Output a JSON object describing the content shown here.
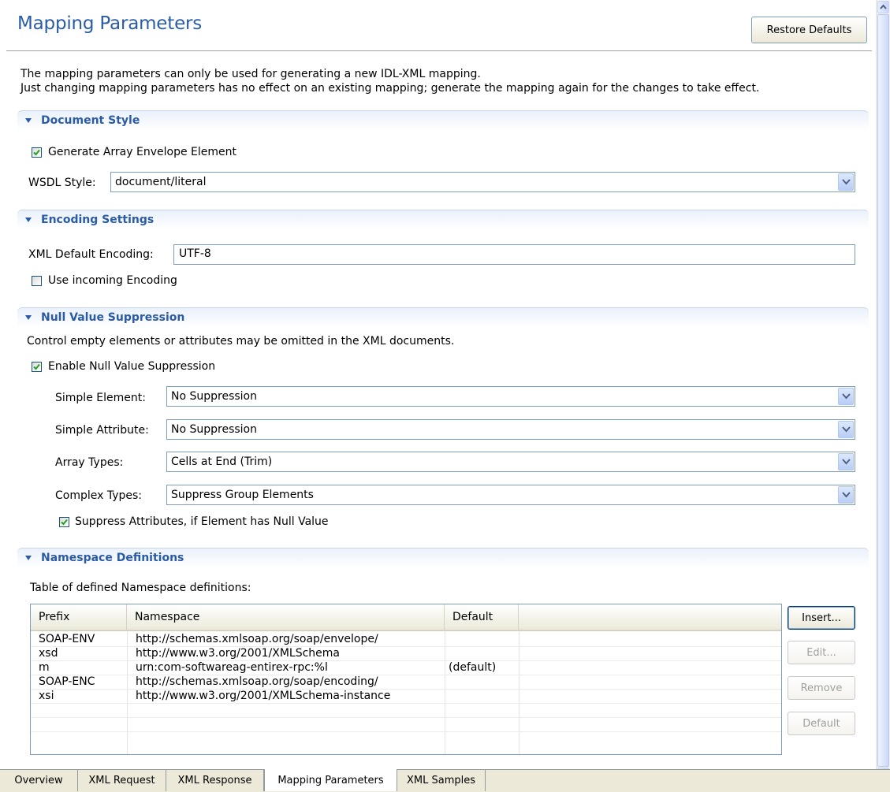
{
  "header": {
    "title": "Mapping Parameters",
    "restore_defaults_label": "Restore Defaults"
  },
  "description": {
    "line1": "The mapping parameters can only be used for generating a new IDL-XML mapping.",
    "line2": "Just changing mapping parameters has no effect on an existing  mapping; generate the mapping again for the changes to take effect."
  },
  "document_style": {
    "section_label": "Document Style",
    "generate_array_envelope": {
      "label": "Generate Array Envelope Element",
      "checked": true
    },
    "wsdl_style": {
      "label": "WSDL Style:",
      "value": "document/literal"
    }
  },
  "encoding_settings": {
    "section_label": "Encoding Settings",
    "xml_default_encoding": {
      "label": "XML Default Encoding:",
      "value": "UTF-8"
    },
    "use_incoming_encoding": {
      "label": "Use incoming Encoding",
      "checked": false
    }
  },
  "null_value_suppression": {
    "section_label": "Null Value Suppression",
    "description": "Control empty elements or attributes may be omitted in the XML documents.",
    "enable": {
      "label": "Enable Null Value Suppression",
      "checked": true
    },
    "simple_element": {
      "label": "Simple Element:",
      "value": "No Suppression"
    },
    "simple_attribute": {
      "label": "Simple Attribute:",
      "value": "No Suppression"
    },
    "array_types": {
      "label": "Array Types:",
      "value": "Cells at End (Trim)"
    },
    "complex_types": {
      "label": "Complex Types:",
      "value": "Suppress Group Elements"
    },
    "suppress_attributes": {
      "label": "Suppress Attributes, if Element has Null Value",
      "checked": true
    }
  },
  "namespace_definitions": {
    "section_label": "Namespace Definitions",
    "table_caption": "Table of defined Namespace definitions:",
    "columns": [
      "Prefix",
      "Namespace",
      "Default"
    ],
    "rows": [
      [
        "SOAP-ENV",
        "http://schemas.xmlsoap.org/soap/envelope/",
        ""
      ],
      [
        "xsd",
        "http://www.w3.org/2001/XMLSchema",
        ""
      ],
      [
        "m",
        "urn:com-softwareag-entirex-rpc:%l",
        "(default)"
      ],
      [
        "SOAP-ENC",
        "http://schemas.xmlsoap.org/soap/encoding/",
        ""
      ],
      [
        "xsi",
        "http://www.w3.org/2001/XMLSchema-instance",
        ""
      ]
    ],
    "buttons": {
      "insert": "Insert...",
      "edit": "Edit...",
      "remove": "Remove",
      "default": "Default"
    }
  },
  "tabs": [
    {
      "label": "Overview",
      "active": false
    },
    {
      "label": "XML Request",
      "active": false
    },
    {
      "label": "XML Response",
      "active": false
    },
    {
      "label": "Mapping Parameters",
      "active": true
    },
    {
      "label": "XML Samples",
      "active": false
    }
  ]
}
